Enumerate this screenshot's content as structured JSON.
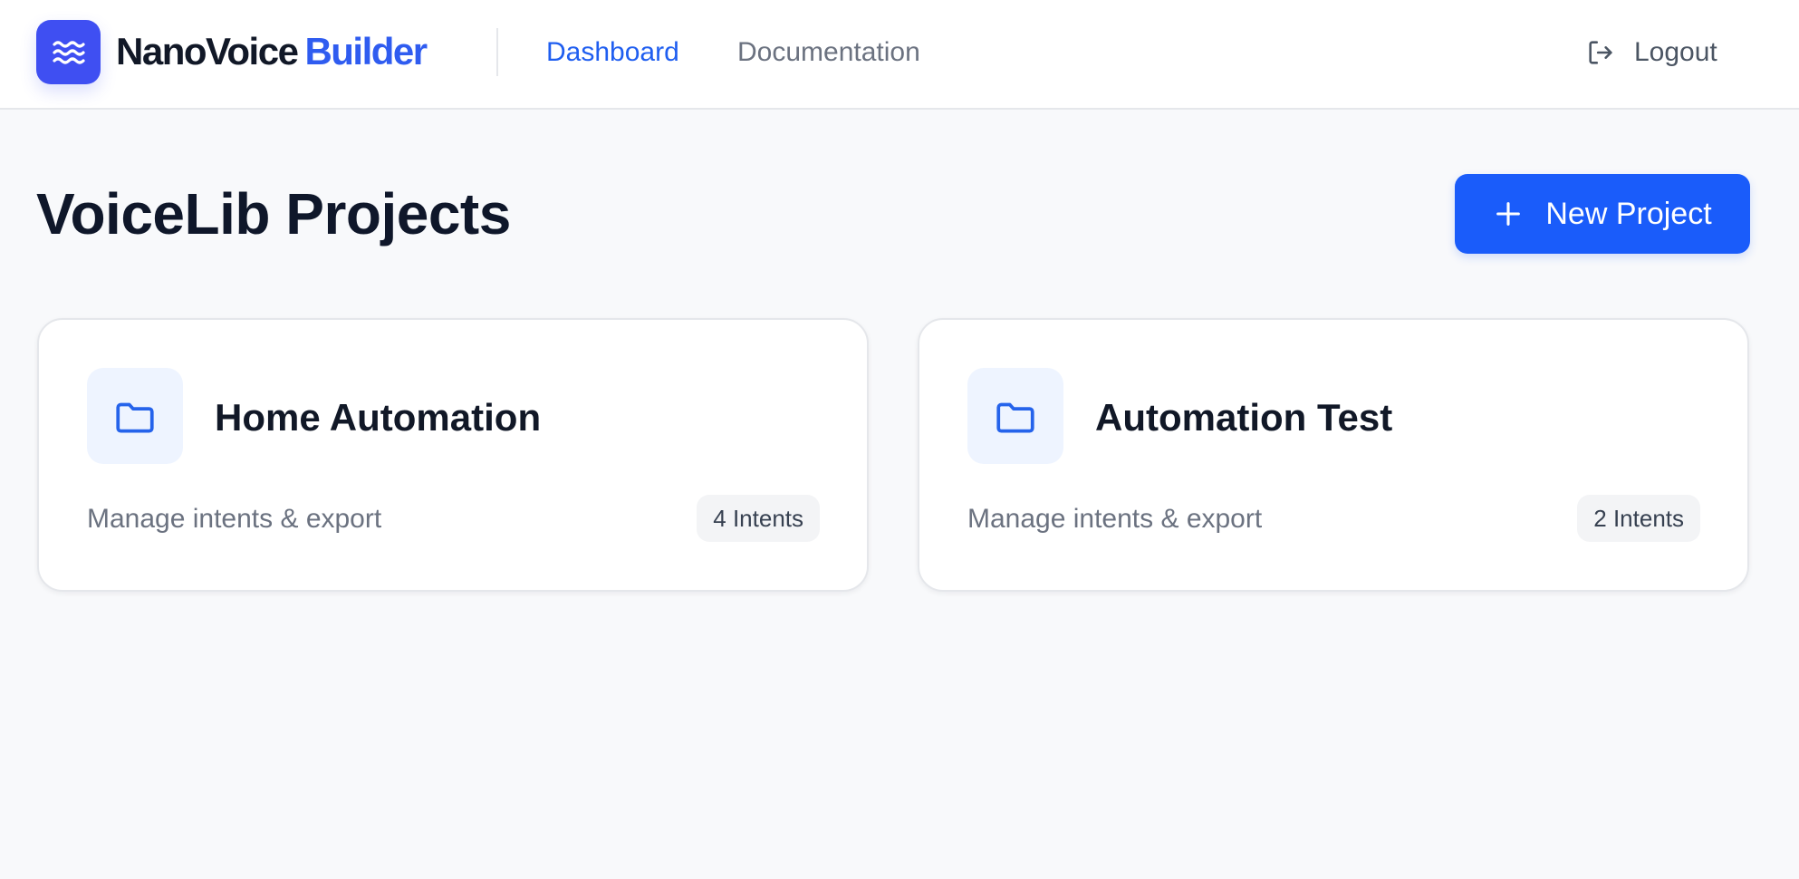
{
  "header": {
    "brand_primary": "NanoVoice",
    "brand_accent": "Builder",
    "logo_icon": "waves-icon",
    "nav": [
      {
        "label": "Dashboard",
        "active": true
      },
      {
        "label": "Documentation",
        "active": false
      }
    ],
    "logout_label": "Logout",
    "logout_icon": "logout-icon"
  },
  "main": {
    "title": "VoiceLib Projects",
    "new_project_label": "New Project",
    "new_project_icon": "plus-icon"
  },
  "projects": [
    {
      "name": "Home Automation",
      "subtitle": "Manage intents & export",
      "badge": "4 Intents",
      "icon": "folder-icon"
    },
    {
      "name": "Automation Test",
      "subtitle": "Manage intents & export",
      "badge": "2 Intents",
      "icon": "folder-icon"
    }
  ],
  "colors": {
    "accent": "#1a5cfa",
    "logo_bg": "#3f4ff2",
    "nav_active": "#1f5ef0",
    "text_dark": "#111827",
    "text_muted": "#6b7280",
    "page_bg": "#f8f9fb"
  }
}
